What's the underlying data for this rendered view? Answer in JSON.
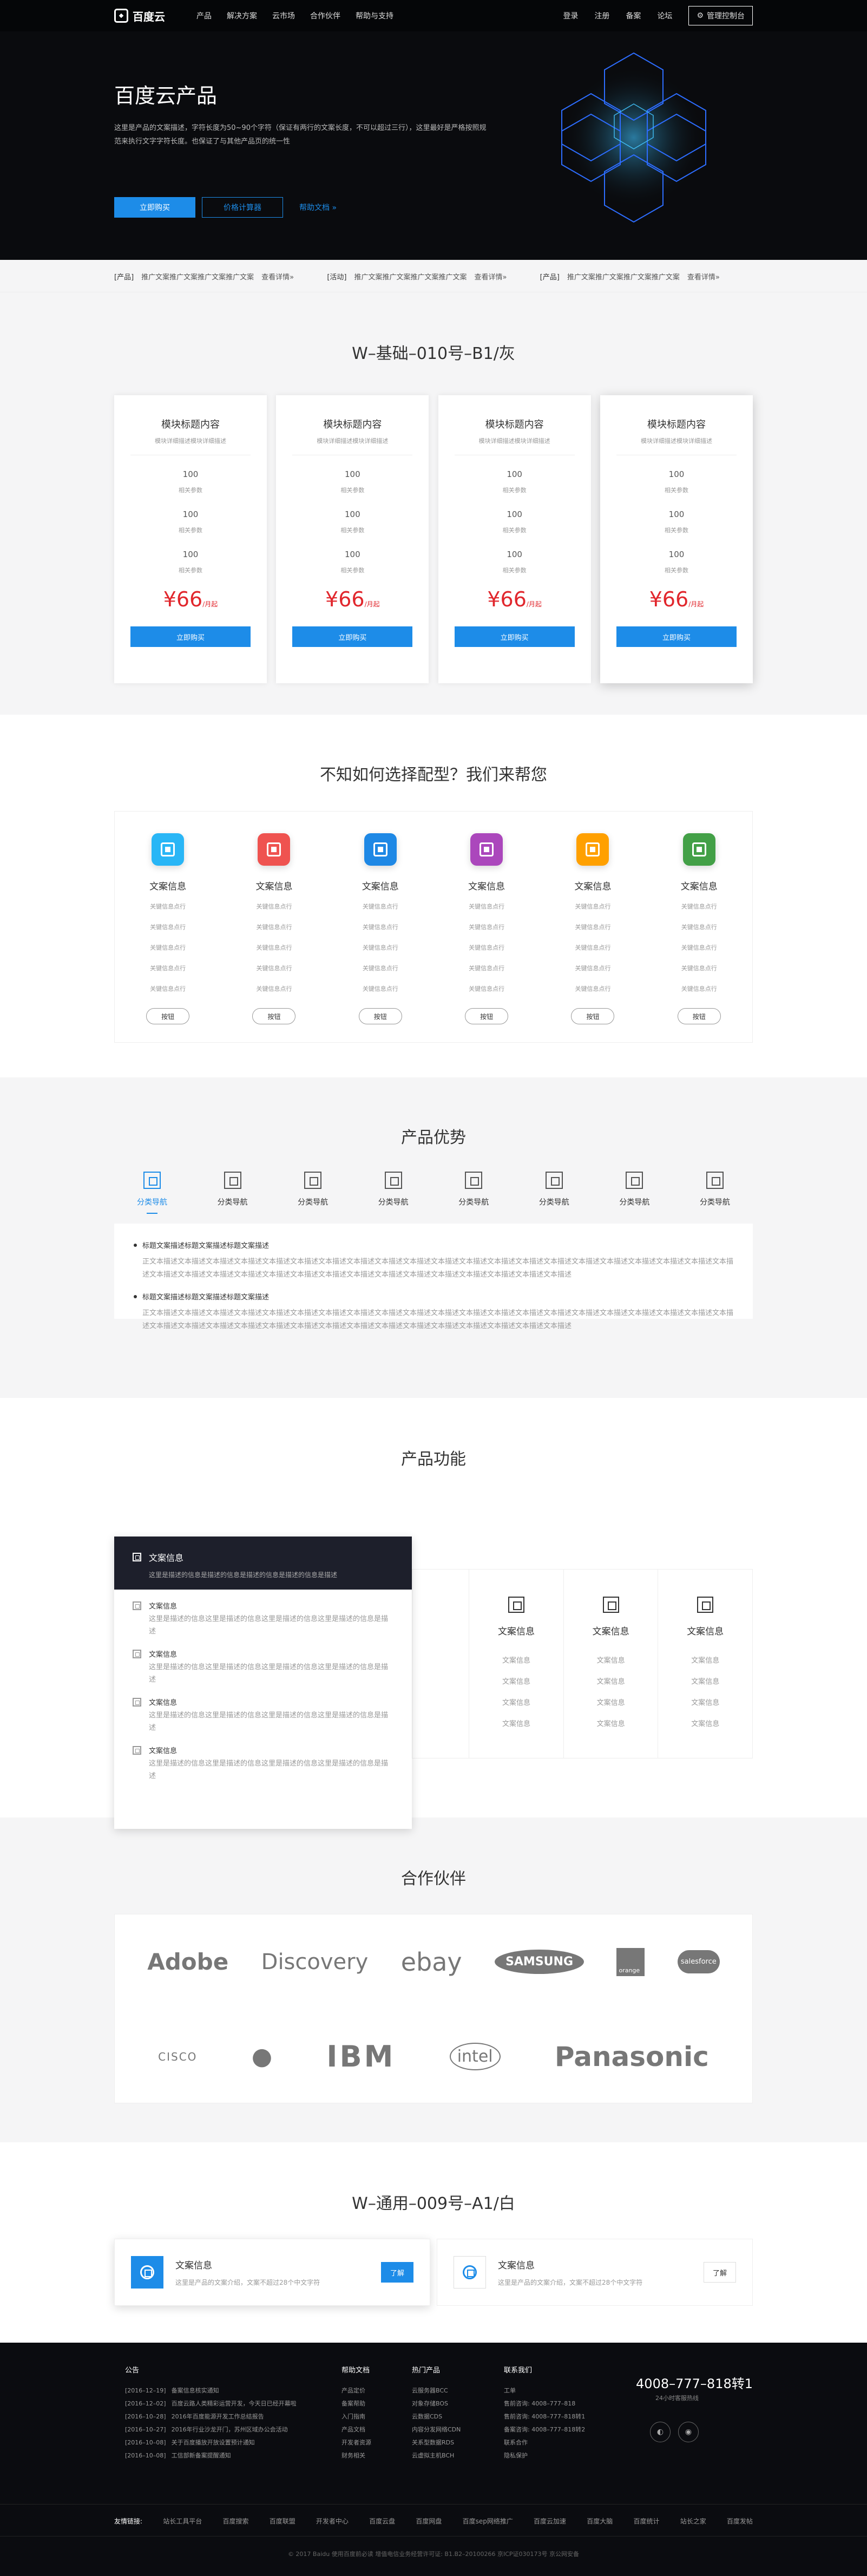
{
  "nav": {
    "brand": "百度云",
    "menu": [
      "产品",
      "解决方案",
      "云市场",
      "合作伙伴",
      "帮助与支持"
    ],
    "right": [
      "登录",
      "注册",
      "备案",
      "论坛"
    ],
    "console": "管理控制台"
  },
  "hero": {
    "title": "百度云产品",
    "desc": "这里是产品的文案描述，字符长度为50~90个字符（保证有两行的文案长度，不可以超过三行），这里最好是严格按照规范来执行文字字符长度。也保证了与其他产品页的统一性",
    "buy": "立即购买",
    "calc": "价格计算器",
    "doc": "帮助文档 »"
  },
  "notice": [
    {
      "tag": "[产品]",
      "text": "推广文案推广文案推广文案推广文案",
      "more": "查看详情»"
    },
    {
      "tag": "[活动]",
      "text": "推广文案推广文案推广文案推广文案",
      "more": "查看详情»"
    },
    {
      "tag": "[产品]",
      "text": "推广文案推广文案推广文案推广文案",
      "more": "查看详情»"
    }
  ],
  "pricing": {
    "title": "W–基础–010号–B1/灰",
    "card_title": "模块标题内容",
    "card_sub": "模块详细描述模块详细描述",
    "num": "100",
    "label": "相关参数",
    "price": "¥66",
    "unit": "/月起",
    "buy": "立即购买"
  },
  "help": {
    "title": "不知如何选择配型？我们来帮您",
    "item_title": "文案信息",
    "kw": "关键信息点行",
    "btn": "按钮",
    "colors": [
      "#29b6f6",
      "#ef5350",
      "#1e88e5",
      "#ab47bc",
      "#ffa000",
      "#43a047"
    ]
  },
  "adv": {
    "title": "产品优势",
    "tab": "分类导航",
    "h1": "标题文案描述标题文案描述标题文案描述",
    "p1": "正文本描述文本描述文本描述文本描述文本描述文本描述文本描述文本描述文本描述文本描述文本描述文本描述文本描述文本描述文本描述文本描述文本描述文本描述文本描述文本描述文本描述文本描述文本描述文本描述文本描述文本描述文本描述文本描述文本描述文本描述文本描述文本描述文本描述文本描述文本描述文本描述",
    "h2": "标题文案描述标题文案描述标题文案描述",
    "p2": "正文本描述文本描述文本描述文本描述文本描述文本描述文本描述文本描述文本描述文本描述文本描述文本描述文本描述文本描述文本描述文本描述文本描述文本描述文本描述文本描述文本描述文本描述文本描述文本描述文本描述文本描述文本描述文本描述文本描述文本描述文本描述文本描述文本描述文本描述文本描述文本描述"
  },
  "func": {
    "title": "产品功能",
    "head_t": "文案信息",
    "head_s": "这里是描述的信息是描述的信息是描述的信息是描述的信息是描述",
    "item_t": "文案信息",
    "item_s": "这里是描述的信息这里是描述的信息这里是描述的信息这里是描述的信息是描述",
    "col_t": "文案信息",
    "col_k": "文案信息"
  },
  "partners": {
    "title": "合作伙伴",
    "row1": [
      "Adobe",
      "Discovery",
      "ebay",
      "SAMSUNG",
      "orange",
      "salesforce"
    ],
    "row2": [
      "CISCO",
      "",
      "IBM",
      "intel",
      "Panasonic"
    ]
  },
  "general": {
    "title": "W–通用–009号–A1/白",
    "t": "文案信息",
    "s": "这里是产品的文案介绍，文案不超过28个中文字符",
    "btn": "了解"
  },
  "footer": {
    "notice_title": "公告",
    "notices": [
      [
        "[2016–12–19]",
        "备案信息核实通知"
      ],
      [
        "[2016–12–02]",
        "百度云路人类精彩运营开发，今天日已经开幕啦"
      ],
      [
        "[2016–10–28]",
        "2016年百度能源开发工作总结报告"
      ],
      [
        "[2016–10–27]",
        "2016年行业沙龙开门，苏州区域办公会活动"
      ],
      [
        "[2016–10–08]",
        "关于百度播放开放设置预计通知"
      ],
      [
        "[2016–10–08]",
        "工信部新备案提醒通知"
      ]
    ],
    "doc_title": "帮助文档",
    "docs": [
      "产品定价",
      "备案帮助",
      "入门指南",
      "产品文档",
      "开发者资源",
      "财务相关"
    ],
    "hot_title": "热门产品",
    "hots": [
      "云服务器BCC",
      "对象存储BOS",
      "云数据CDS",
      "内容分发网络CDN",
      "关系型数据RDS",
      "云虚拟主机BCH"
    ],
    "contact_title": "联系我们",
    "contacts": [
      "工单",
      "售前咨询: 4008–777–818",
      "售前咨询: 4008–777–818转1",
      "备案咨询: 4008–777–818转2",
      "联系合作",
      "隐私保护"
    ],
    "tel": "4008–777–818转1",
    "tel_sub": "24小时客服热线",
    "links_label": "友情链接:",
    "links": [
      "站长工具平台",
      "百度搜索",
      "百度联盟",
      "开发者中心",
      "百度云盘",
      "百度网盘",
      "百度sep网络推广",
      "百度云加速",
      "百度大脑",
      "百度统计",
      "站长之家",
      "百度发帖"
    ],
    "copy": "© 2017 Baidu 使用百度前必读   增值电信业务经营许可证: B1.B2–20100266   京ICP证030173号   京公网安备"
  }
}
